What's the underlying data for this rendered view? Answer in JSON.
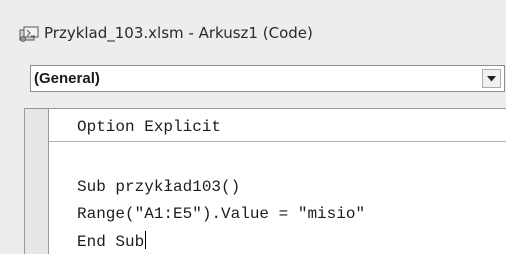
{
  "window": {
    "title": "Przyklad_103.xlsm - Arkusz1 (Code)",
    "icon": "vba-module-icon"
  },
  "object_dropdown": {
    "selected_value": "(General)",
    "button_icon": "chevron-down-icon"
  },
  "code_editor": {
    "lines": [
      "Option Explicit",
      "",
      "Sub przykład103()",
      "Range(\"A1:E5\").Value = \"misio\"",
      "End Sub"
    ]
  }
}
